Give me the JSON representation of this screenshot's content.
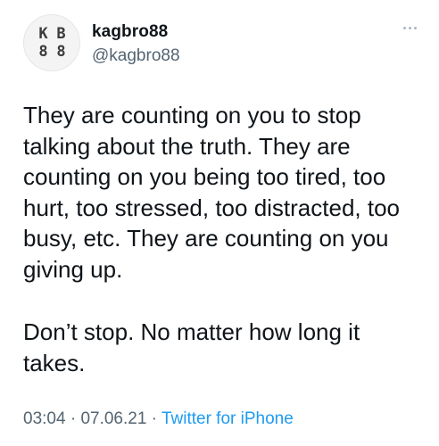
{
  "user": {
    "display_name": "kagbro88",
    "handle": "@kagbro88",
    "avatar_text": {
      "top_left": "K",
      "top_right": "B",
      "bottom_left": "8",
      "bottom_right": "8"
    },
    "avatar_icon": "kb88-logo-icon"
  },
  "menu": {
    "icon": "more-dots-icon"
  },
  "tweet": {
    "paragraph_1": "They are counting on you to stop talking about the truth. They are counting on you being too tired, too hurt, too stressed, too distracted, too busy, etc. They are counting on you giving up.",
    "paragraph_2": "Don’t stop. No matter how long it takes."
  },
  "meta": {
    "time": "03:04",
    "separator": " · ",
    "date": "07.06.21",
    "source": "Twitter for iPhone"
  },
  "colors": {
    "text": "#0f1419",
    "secondary": "#536471",
    "link": "#1d9bf0"
  }
}
